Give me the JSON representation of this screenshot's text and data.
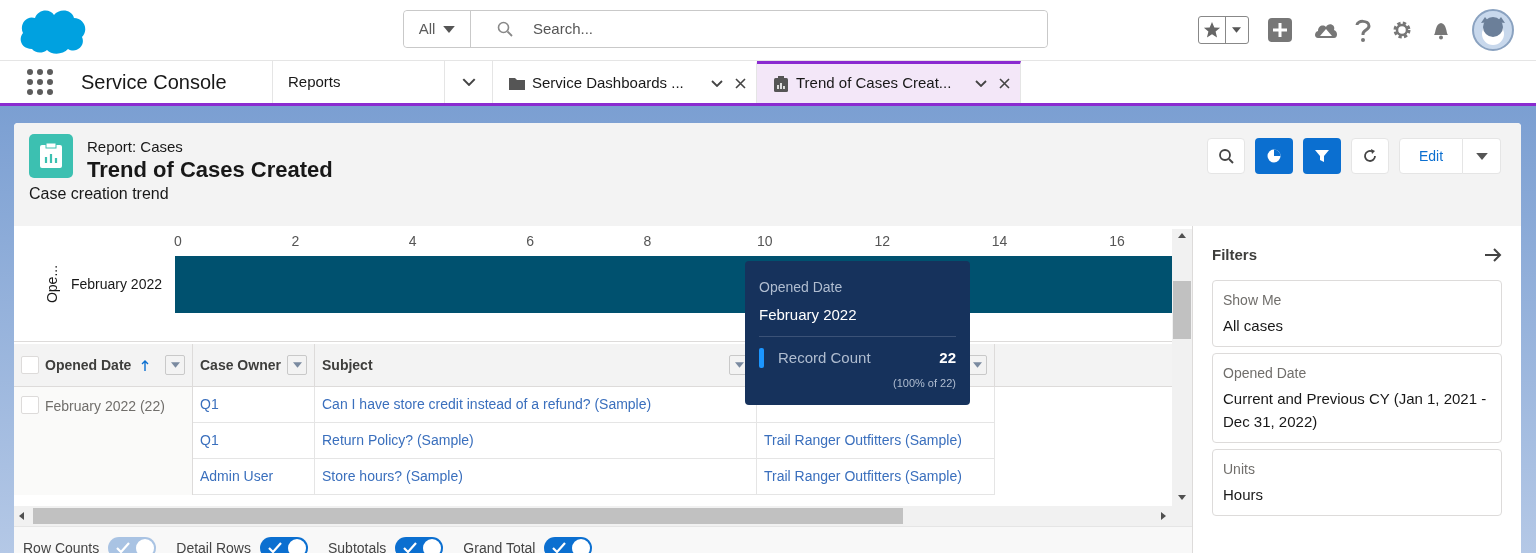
{
  "search": {
    "scope": "All",
    "placeholder": "Search..."
  },
  "app_name": "Service Console",
  "nav_menu": {
    "label": "Reports"
  },
  "tabs": [
    {
      "label": "Service Dashboards ...",
      "kind": "folder",
      "selected": false
    },
    {
      "label": "Trend of Cases Creat...",
      "kind": "report",
      "selected": true
    }
  ],
  "report": {
    "type": "Report: Cases",
    "title": "Trend of Cases Created",
    "description": "Case creation trend"
  },
  "toolbar": [
    {
      "kind": "search",
      "selected": false
    },
    {
      "kind": "chart",
      "selected": true
    },
    {
      "kind": "filter",
      "selected": true
    },
    {
      "kind": "refresh",
      "selected": false
    }
  ],
  "edit_button": "Edit",
  "chart": {
    "axis_title": "Ope...",
    "categories": [
      "February 2022"
    ],
    "tick_labels": [
      "0",
      "2",
      "4",
      "6",
      "8",
      "10",
      "12",
      "14",
      "16"
    ]
  },
  "tooltip": {
    "label": "Opened Date",
    "value": "February 2022",
    "measure": "Record Count",
    "count": "22",
    "share": "(100% of 22)"
  },
  "table": {
    "header_checked": false,
    "columns": [
      {
        "label": "Opened Date",
        "sorted": true
      },
      {
        "label": "Case Owner",
        "sorted": false
      },
      {
        "label": "Subject",
        "sorted": false
      }
    ],
    "groups": [
      {
        "label": "February 2022 (22)",
        "checked": false,
        "rows": [
          {
            "cells": [
              "Q1",
              "Can I have store credit instead of a refund? (Sample)"
            ]
          },
          {
            "cells": [
              "Q1",
              "Return Policy? (Sample)",
              "Trail Ranger Outfitters (Sample)"
            ]
          },
          {
            "cells": [
              "Admin User",
              "Store hours? (Sample)",
              "Trail Ranger Outfitters (Sample)"
            ]
          }
        ]
      }
    ]
  },
  "toggles": [
    {
      "label": "Row Counts",
      "on": true,
      "disabled": true
    },
    {
      "label": "Detail Rows",
      "on": true,
      "disabled": false
    },
    {
      "label": "Subtotals",
      "on": true,
      "disabled": false
    },
    {
      "label": "Grand Total",
      "on": true,
      "disabled": false
    }
  ],
  "filters": {
    "title": "Filters",
    "items": [
      {
        "label": "Show Me",
        "value": "All cases"
      },
      {
        "label": "Opened Date",
        "value": "Current and Previous CY (Jan 1, 2021 - Dec 31, 2022)"
      },
      {
        "label": "Units",
        "value": "Hours"
      }
    ]
  }
}
